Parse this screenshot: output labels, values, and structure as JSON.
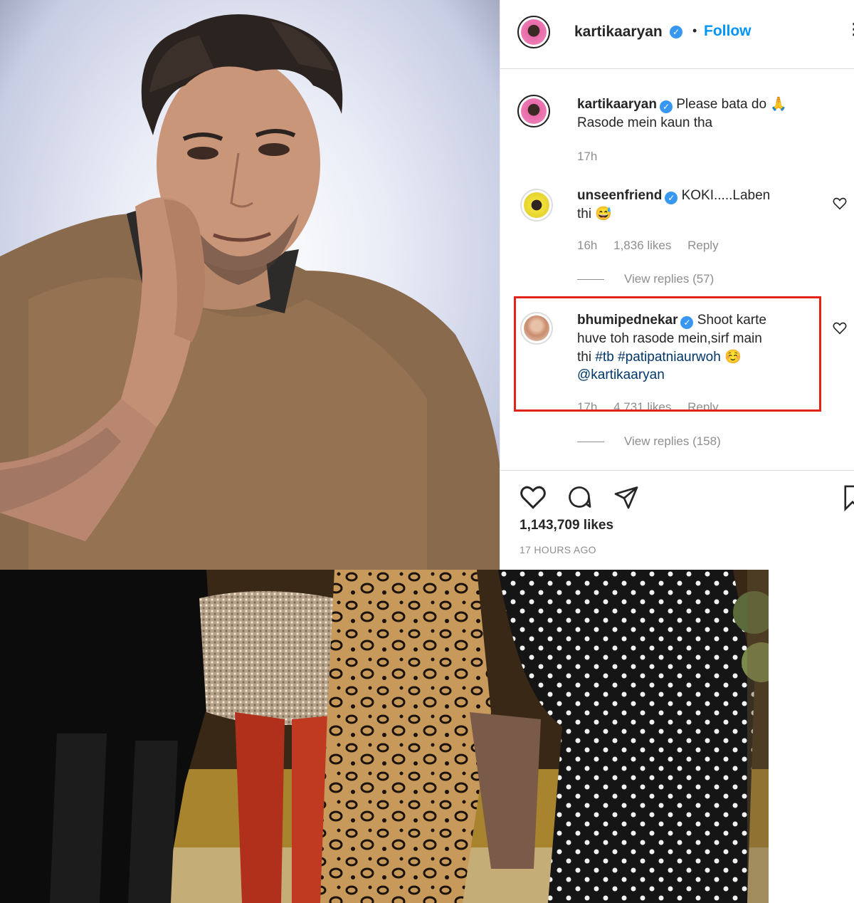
{
  "header": {
    "username": "kartikaaryan",
    "separator": "•",
    "follow_label": "Follow",
    "more_icon": "more-icon"
  },
  "caption": {
    "username": "kartikaaryan",
    "text_line1": "Please bata do 🙏",
    "text_line2": "Rasode mein kaun tha",
    "time": "17h"
  },
  "comments": [
    {
      "username": "unseenfriend",
      "text_line1": "KOKI.....Laben",
      "text_line2": "thi 😅",
      "time": "16h",
      "likes": "1,836 likes",
      "reply": "Reply",
      "view_replies": "View replies (57)"
    },
    {
      "username": "bhumipednekar",
      "text_line1": "Shoot karte",
      "text_line2": "huve toh rasode mein,sirf main",
      "text_line3_prefix": "thi",
      "tag1": "#tb",
      "tag2": "#patipatniaurwoh",
      "emoji": "☺️",
      "mention": "@kartikaaryan",
      "time": "17h",
      "likes": "4,731 likes",
      "reply": "Reply",
      "view_replies": "View replies (158)"
    }
  ],
  "footer": {
    "likes": "1,143,709 likes",
    "time_ago": "17 HOURS AGO"
  },
  "colors": {
    "follow_blue": "#0095f6",
    "verified_blue": "#3897f0",
    "highlight_red": "#e2231a",
    "text_dark": "#262626",
    "text_gray": "#8e8e8e"
  }
}
